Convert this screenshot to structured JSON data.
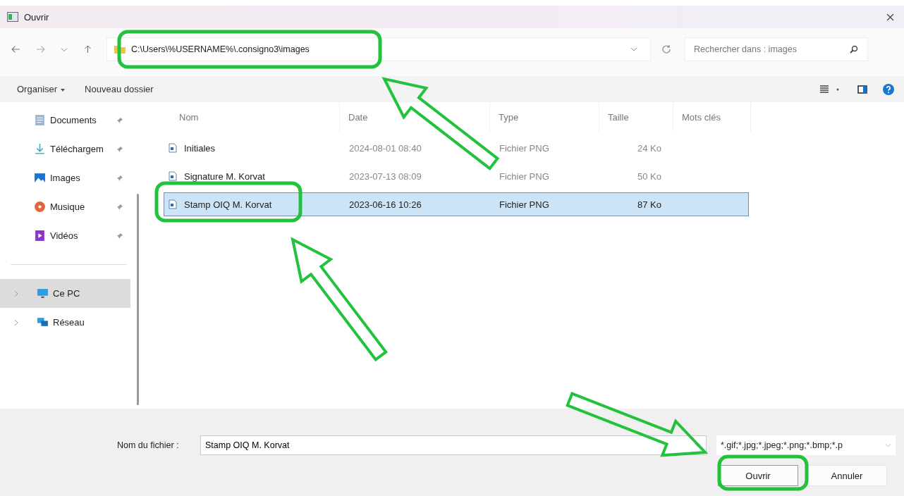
{
  "window": {
    "title": "Ouvrir"
  },
  "navigation": {
    "address": "C:\\Users\\%USERNAME%\\.consigno3\\images",
    "search_placeholder": "Rechercher dans : images"
  },
  "toolbar": [
    {
      "label": "Organiser",
      "dropdown": true
    },
    {
      "label": "Nouveau dossier",
      "dropdown": false
    }
  ],
  "sidebar": {
    "items": [
      {
        "label": "Documents",
        "kind": "documents",
        "pinned": true,
        "expandable": false,
        "selected": false
      },
      {
        "label": "Téléchargem",
        "kind": "download",
        "pinned": true,
        "expandable": false,
        "selected": false
      },
      {
        "label": "Images",
        "kind": "images",
        "pinned": true,
        "expandable": false,
        "selected": false
      },
      {
        "label": "Musique",
        "kind": "music",
        "pinned": true,
        "expandable": false,
        "selected": false
      },
      {
        "label": "Vidéos",
        "kind": "videos",
        "pinned": true,
        "expandable": false,
        "selected": false
      },
      {
        "label": "Ce PC",
        "kind": "pc",
        "pinned": false,
        "expandable": true,
        "selected": true
      },
      {
        "label": "Réseau",
        "kind": "network",
        "pinned": false,
        "expandable": true,
        "selected": false
      }
    ]
  },
  "table": {
    "columns": [
      "Nom",
      "Date",
      "Type",
      "Taille",
      "Mots clés"
    ],
    "rows": [
      {
        "name": "Initiales",
        "date": "2024-08-01 08:40",
        "type": "Fichier PNG",
        "size": "24 Ko",
        "selected": false
      },
      {
        "name": "Signature M. Korvat",
        "date": "2023-07-13 08:09",
        "type": "Fichier PNG",
        "size": "50 Ko",
        "selected": false
      },
      {
        "name": "Stamp OIQ M. Korvat",
        "date": "2023-06-16 10:26",
        "type": "Fichier PNG",
        "size": "87 Ko",
        "selected": true
      }
    ]
  },
  "footer": {
    "filename_label": "Nom du fichier :",
    "filename": "Stamp OIQ M. Korvat",
    "filter": "*.gif;*.jpg;*.jpeg;*.png;*.bmp;*.p",
    "buttons": [
      {
        "label": "Ouvrir",
        "primary": true
      },
      {
        "label": "Annuler",
        "primary": false
      }
    ]
  }
}
